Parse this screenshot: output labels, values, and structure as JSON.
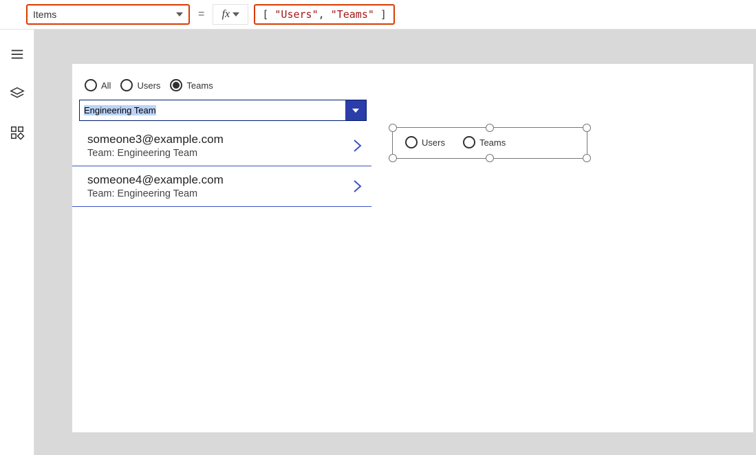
{
  "formula_bar": {
    "property": "Items",
    "equals": "=",
    "fx": "fx",
    "value_prefix": "[ ",
    "value_str1": "\"Users\"",
    "value_sep": ", ",
    "value_str2": "\"Teams\"",
    "value_suffix": " ]"
  },
  "radios_top": {
    "all": "All",
    "users": "Users",
    "teams": "Teams"
  },
  "dropdown": {
    "value": "Engineering Team"
  },
  "list": [
    {
      "title": "someone3@example.com",
      "sub": "Team: Engineering Team"
    },
    {
      "title": "someone4@example.com",
      "sub": "Team: Engineering Team"
    }
  ],
  "radios_selected": {
    "users": "Users",
    "teams": "Teams"
  }
}
